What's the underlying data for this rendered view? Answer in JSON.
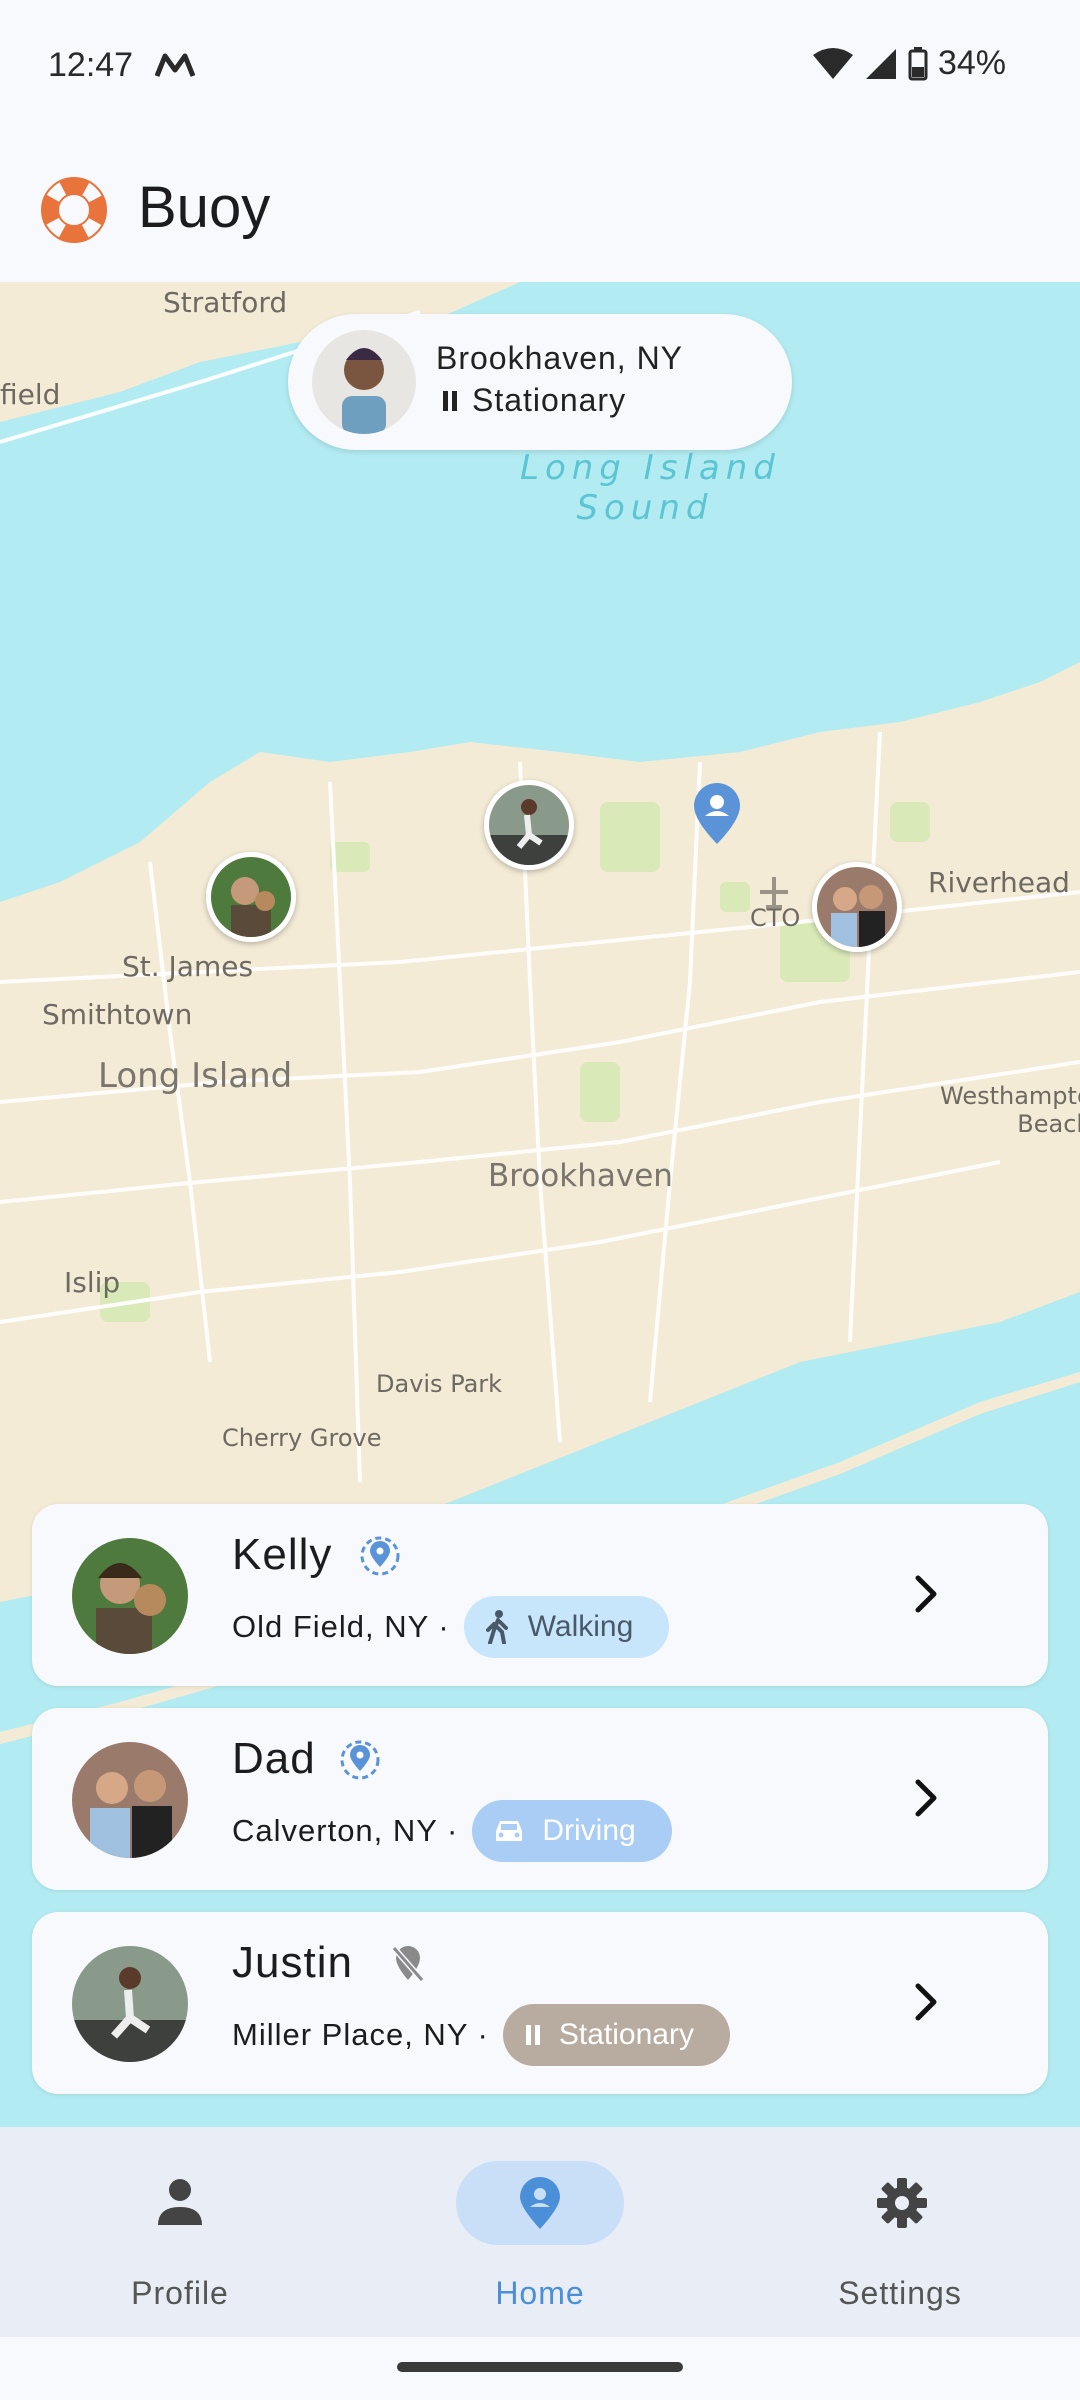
{
  "status_bar": {
    "time": "12:47",
    "battery": "34%",
    "icons": [
      "gmail-m-icon",
      "wifi-icon",
      "signal-icon",
      "battery-icon"
    ]
  },
  "app_bar": {
    "title": "Buoy",
    "logo_icon": "lifebuoy-icon",
    "accent": "#e8743b"
  },
  "map": {
    "labels": {
      "stratford": "Stratford",
      "field": "field",
      "sound": "Long Island\nSound",
      "st_james": "St. James",
      "smithtown": "Smithtown",
      "long_island": "Long Island",
      "riverhead": "Riverhead",
      "cto": "CTO",
      "westhampton": "Westhampto\nBeach",
      "brookhaven": "Brookhaven",
      "islip": "Islip",
      "davis_park": "Davis Park",
      "cherry_grove": "Cherry Grove"
    },
    "self_location": {
      "place": "Brookhaven, NY",
      "status": "Stationary"
    }
  },
  "people": [
    {
      "name": "Kelly",
      "place": "Old Field, NY ·",
      "activity": "Walking",
      "sharing": "location-sharing-icon"
    },
    {
      "name": "Dad",
      "place": "Calverton, NY ·",
      "activity": "Driving",
      "sharing": "location-sharing-icon"
    },
    {
      "name": "Justin",
      "place": "Miller Place, NY ·",
      "activity": "Stationary",
      "sharing": "location-off-icon"
    }
  ],
  "bottom_nav": {
    "items": [
      {
        "label": "Profile",
        "icon": "person-icon"
      },
      {
        "label": "Home",
        "icon": "home-pin-icon",
        "active": true
      },
      {
        "label": "Settings",
        "icon": "gear-icon"
      }
    ]
  },
  "colors": {
    "water": "#b2ecf2",
    "land": "#f3ebd6",
    "park": "#d9e9b8",
    "active_nav": "#c9dff7",
    "pin_blue": "#5b93d8"
  }
}
